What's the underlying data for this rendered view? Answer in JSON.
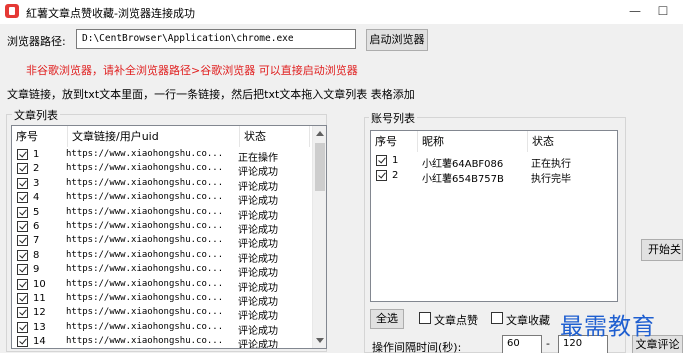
{
  "window": {
    "title": "紅薯文章点赞收藏-浏览器连接成功",
    "minimize_icon": "minimize-icon",
    "maximize_icon": "maximize-icon"
  },
  "browser": {
    "path_label": "浏览器路径:",
    "path_value": "D:\\CentBrowser\\Application\\chrome.exe",
    "launch_button": "启动浏览器"
  },
  "notices": {
    "warning": "非谷歌浏览器，请补全浏览器路径>谷歌浏览器 可以直接启动浏览器",
    "instructions": "文章链接，放到txt文本里面，一行一条链接，然后把txt文本拖入文章列表 表格添加"
  },
  "article_list": {
    "title": "文章列表",
    "columns": [
      "序号",
      "文章链接/用户uid",
      "状态"
    ],
    "rows": [
      {
        "index": "1",
        "link": "https://www.xiaohongshu.co...",
        "status": "正在操作"
      },
      {
        "index": "2",
        "link": "https://www.xiaohongshu.co...",
        "status": "评论成功"
      },
      {
        "index": "3",
        "link": "https://www.xiaohongshu.co...",
        "status": "评论成功"
      },
      {
        "index": "4",
        "link": "https://www.xiaohongshu.co...",
        "status": "评论成功"
      },
      {
        "index": "5",
        "link": "https://www.xiaohongshu.co...",
        "status": "评论成功"
      },
      {
        "index": "6",
        "link": "https://www.xiaohongshu.co...",
        "status": "评论成功"
      },
      {
        "index": "7",
        "link": "https://www.xiaohongshu.co...",
        "status": "评论成功"
      },
      {
        "index": "8",
        "link": "https://www.xiaohongshu.co...",
        "status": "评论成功"
      },
      {
        "index": "9",
        "link": "https://www.xiaohongshu.co...",
        "status": "评论成功"
      },
      {
        "index": "10",
        "link": "https://www.xiaohongshu.co...",
        "status": "评论成功"
      },
      {
        "index": "11",
        "link": "https://www.xiaohongshu.co...",
        "status": "评论成功"
      },
      {
        "index": "12",
        "link": "https://www.xiaohongshu.co...",
        "status": "评论成功"
      },
      {
        "index": "13",
        "link": "https://www.xiaohongshu.co...",
        "status": "评论成功"
      },
      {
        "index": "14",
        "link": "https://www.xiaohongshu.co...",
        "status": "评论成功"
      }
    ]
  },
  "account_list": {
    "title": "账号列表",
    "columns": [
      "序号",
      "昵称",
      "状态"
    ],
    "rows": [
      {
        "index": "1",
        "nickname": "小红薯64ABF086",
        "status": "正在执行"
      },
      {
        "index": "2",
        "nickname": "小红薯654B757B",
        "status": "执行完毕"
      }
    ]
  },
  "controls": {
    "select_all": "全选",
    "like_article": "文章点赞",
    "collect_article": "文章收藏",
    "interval_label": "操作间隔时间(秒):",
    "interval_min": "60",
    "interval_sep": "-",
    "interval_max": "120",
    "start_button": "开始关",
    "comment_button": "文章评论"
  },
  "watermark": "最需教育"
}
